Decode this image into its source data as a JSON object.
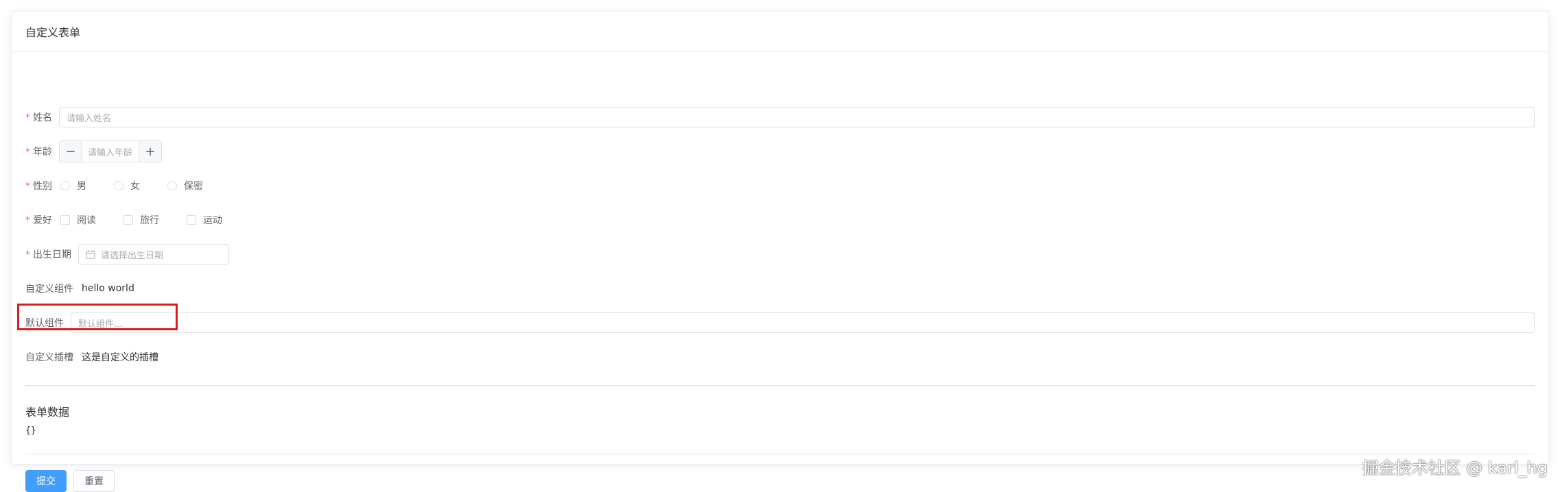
{
  "card": {
    "title": "自定义表单"
  },
  "form": {
    "name": {
      "label": "姓名",
      "placeholder": "请输入姓名"
    },
    "age": {
      "label": "年龄",
      "placeholder": "请输入年龄",
      "minus": "−",
      "plus": "+"
    },
    "gender": {
      "label": "性别",
      "options": [
        "男",
        "女",
        "保密"
      ]
    },
    "hobby": {
      "label": "爱好",
      "options": [
        "阅读",
        "旅行",
        "运动"
      ]
    },
    "birthday": {
      "label": "出生日期",
      "placeholder": "请选择出生日期"
    },
    "custom_component": {
      "label": "自定义组件",
      "value": "hello world"
    },
    "default_component": {
      "label": "默认组件",
      "placeholder": "默认组件..."
    },
    "custom_slot": {
      "label": "自定义插槽",
      "value": "这是自定义的插槽"
    }
  },
  "form_data": {
    "title": "表单数据",
    "value": "{}"
  },
  "actions": {
    "submit": "提交",
    "reset": "重置"
  },
  "watermark": "掘金技术社区 @ karl_hg",
  "colors": {
    "primary": "#409eff",
    "required": "#f56c6c",
    "highlight": "#d81e1e"
  }
}
